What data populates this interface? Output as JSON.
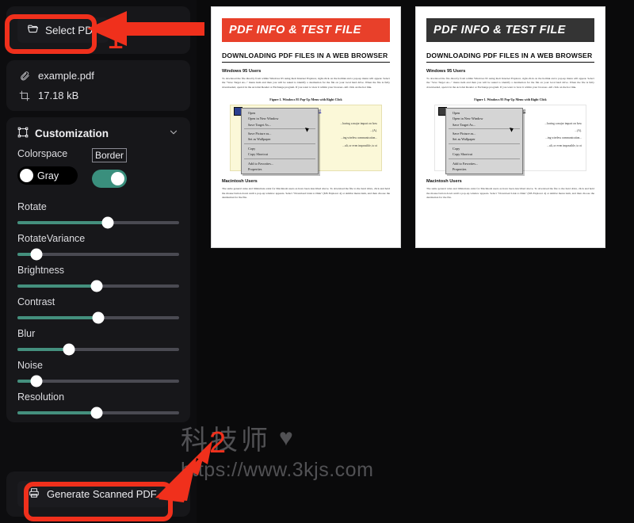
{
  "sidebar": {
    "select_pdf": {
      "label": "Select PDF",
      "icon": "folder-open-icon"
    },
    "file": {
      "name": "example.pdf",
      "name_icon": "paperclip-icon",
      "size": "17.18 kB",
      "size_icon": "crop-frame-icon"
    },
    "customization": {
      "title": "Customization",
      "title_icon": "transform-icon",
      "collapse_icon": "chevron-down-icon",
      "colorspace": {
        "label": "Colorspace",
        "toggle_text": "Gray",
        "on": false
      },
      "border": {
        "label": "Border",
        "on": true
      },
      "sliders": [
        {
          "label": "Rotate",
          "percent": 56
        },
        {
          "label": "RotateVariance",
          "percent": 12
        },
        {
          "label": "Brightness",
          "percent": 49
        },
        {
          "label": "Contrast",
          "percent": 50
        },
        {
          "label": "Blur",
          "percent": 32
        },
        {
          "label": "Noise",
          "percent": 12
        },
        {
          "label": "Resolution",
          "percent": 49
        }
      ]
    },
    "generate": {
      "label": "Generate Scanned PDF",
      "icon": "printer-icon"
    }
  },
  "document": {
    "banner": "PDF INFO & TEST FILE",
    "heading": "DOWNLOADING PDF FILES IN A WEB BROWSER",
    "section1_title": "Windows 95 Users",
    "section1_body": "To download the file directly from within Windows 95 using their Internet Explorer, right-click on the hotlink and a pop-up menu will appear. Select the \"Save Target As...\" menu item and then you will be asked to identify a destination for the file on your local hard drive. When the file is fully downloaded, open it in the Acrobat Reader or Exchange program. If you want to view it within your browser--left click on the hot link.",
    "figure_caption": "Figure 1. Windows 95 Pop-Up Menu with Right Click",
    "figure_link": "Download Article in PDF Format (175 k)",
    "context_menu": [
      "Open",
      "Open in New Window",
      "Save Target As...",
      "Save Picture as...",
      "Set as Wallpaper",
      "Copy",
      "Copy Shortcut",
      "Add to Favorites...",
      "Properties"
    ],
    "figure_text_lines": [
      "...having a major impact on how",
      "...(A).",
      "...ing wireless communication...",
      "...ult, or even impossible, to ot"
    ],
    "section2_title": "Macintosh Users",
    "section2_body": "The same general rules and limitations exist for Macintosh users as have been described above. To download the file to the hard drive, click and hold the mouse button down until a pop-up window appears. Select \"Download Link to Disk\" (MS Explorer 4) or similar menu item, and then choose the destination for the file."
  },
  "annotations": {
    "step1": "1",
    "step2": "2",
    "highlight_color": "#f0301c"
  },
  "watermark": {
    "brand": "科技师",
    "heart": "♥",
    "url": "https://www.3kjs.com"
  }
}
